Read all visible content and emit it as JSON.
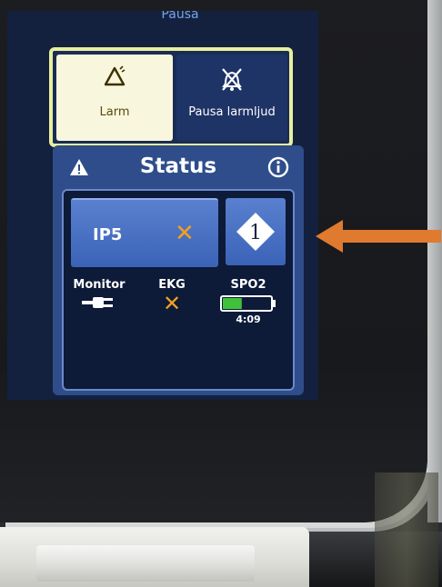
{
  "screen": {
    "top_label": "Pausa"
  },
  "buttons": {
    "larm": {
      "label": "Larm",
      "icon": "alarm-triangle-icon",
      "state": "selected"
    },
    "pausa": {
      "label": "Pausa larmljud",
      "icon": "alarm-mute-icon"
    }
  },
  "status": {
    "title": "Status",
    "left_icon": "warning-icon",
    "right_icon": "info-icon",
    "ip5": {
      "label": "IP5",
      "indicator": "✕",
      "indicator_icon": "error-x-icon"
    },
    "badge": {
      "number": "1",
      "icon": "diamond-number-icon"
    },
    "monitor": {
      "label": "Monitor",
      "icon": "plug-icon"
    },
    "ekg": {
      "label": "EKG",
      "indicator": "✕",
      "indicator_icon": "error-x-icon"
    },
    "spo2": {
      "label": "SPO2",
      "battery_time": "4:09",
      "battery_level": 0.4,
      "icon": "battery-icon"
    }
  },
  "colors": {
    "accent_orange": "#f0a022",
    "selected_button": "#f8f6dc",
    "panel_blue": "#2e4d8a",
    "arrow": "#e07a2f",
    "battery_green": "#3fc23a"
  },
  "annotation": {
    "icon": "orange-arrow-icon"
  }
}
